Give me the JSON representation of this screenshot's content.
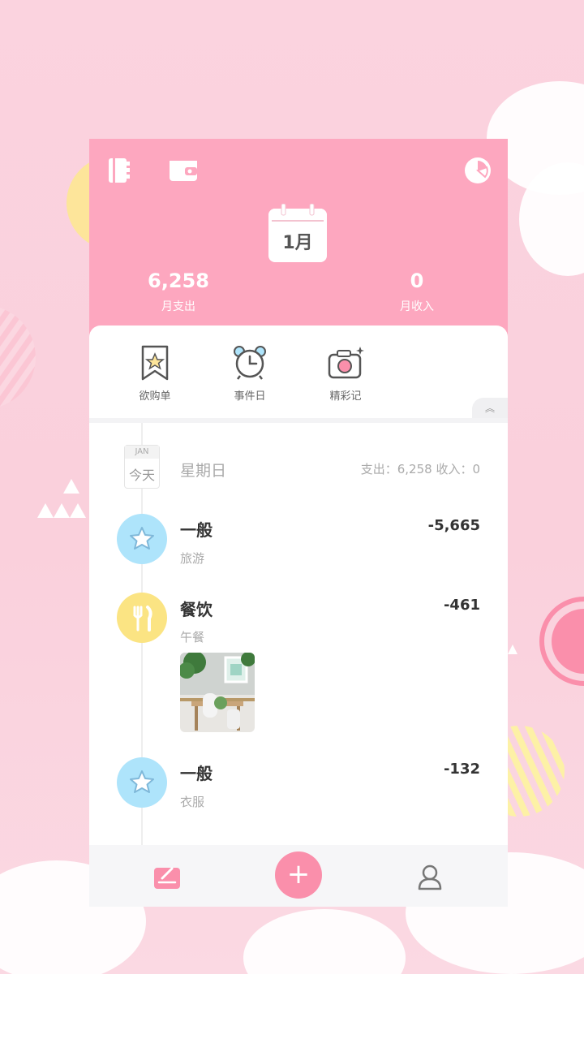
{
  "colors": {
    "header_pink": "#fda7bf",
    "accent_pink": "#fa8fab",
    "blue_bubble": "#aee4fb",
    "yellow_bubble": "#fbe483"
  },
  "header": {
    "left_icons": [
      "notebook-icon",
      "wallet-icon"
    ],
    "right_icon": "pie-chart-icon",
    "calendar_month": "1月",
    "expense_value": "6,258",
    "expense_label": "月支出",
    "income_value": "0",
    "income_label": "月收入"
  },
  "quick_actions": [
    {
      "label": "欲购单",
      "icon": "bookmark-star-icon"
    },
    {
      "label": "事件日",
      "icon": "alarm-clock-icon"
    },
    {
      "label": "精彩记",
      "icon": "camera-icon"
    }
  ],
  "collapse_icon": "double-chevron-up-icon",
  "day": {
    "month_abbr": "JAN",
    "today_label": "今天",
    "weekday": "星期日",
    "summary": "支出：6,258  收入：0"
  },
  "entries": [
    {
      "title": "一般",
      "note": "旅游",
      "amount": "-5,665",
      "icon": "star-icon"
    },
    {
      "title": "餐饮",
      "note": "午餐",
      "amount": "-461",
      "icon": "fork-knife-icon"
    },
    {
      "title": "一般",
      "note": "衣服",
      "amount": "-132",
      "icon": "star-icon"
    }
  ],
  "tabbar": {
    "left_icon": "edit-note-icon",
    "center_label": "+",
    "right_icon": "user-icon"
  }
}
